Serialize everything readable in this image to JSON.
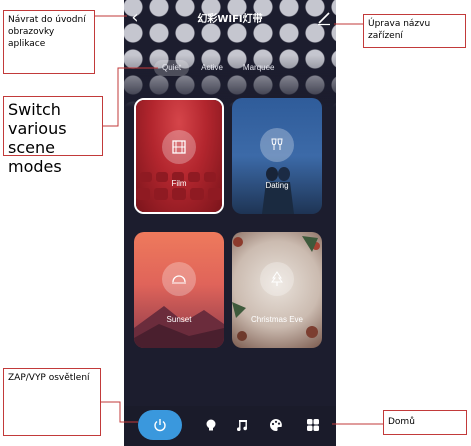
{
  "app": {
    "title": "幻彩WIFI灯带",
    "back_icon": "chevron-left-icon",
    "edit_icon": "pencil-icon"
  },
  "mode_tabs": [
    {
      "label": "Quiet",
      "active": true
    },
    {
      "label": "Active",
      "active": false
    },
    {
      "label": "Marquee",
      "active": false
    }
  ],
  "scenes": [
    {
      "label": "Film",
      "icon": "film-icon",
      "selected": true
    },
    {
      "label": "Dating",
      "icon": "wine-glasses-icon",
      "selected": false
    },
    {
      "label": "Sunset",
      "icon": "sunset-icon",
      "selected": false
    },
    {
      "label": "Christmas Eve",
      "icon": "christmas-tree-icon",
      "selected": false
    }
  ],
  "bottom_nav": {
    "items": [
      "power-icon",
      "bulb-icon",
      "music-icon",
      "palette-icon",
      "grid-icon"
    ]
  },
  "callouts": {
    "back": "Návrat do úvodní obrazovky aplikace",
    "edit": "Úprava názvu zařízení",
    "switch": "Switch various scene modes",
    "power": "ZAP/VYP osvětlení",
    "home": "Domů"
  },
  "colors": {
    "background": "#1c1d2e",
    "accent": "#3a98dd",
    "callout_border": "#c23a3a"
  }
}
